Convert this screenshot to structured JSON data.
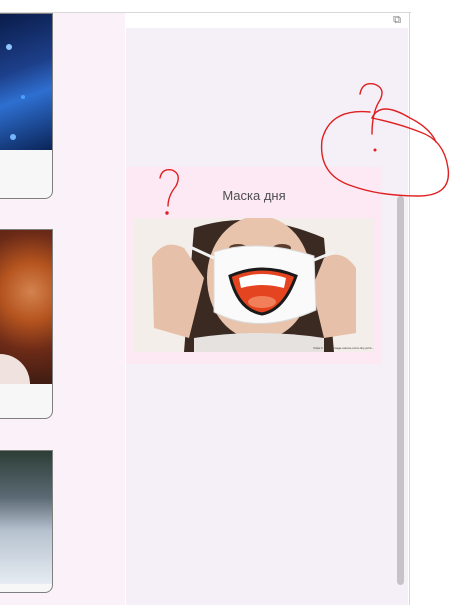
{
  "widget": {
    "title": "Маска дня",
    "image_caption": "https://...mask-image-source-url-in-tiny-print..."
  },
  "icons": {
    "corner": "window-restore-icon"
  },
  "annotations": {
    "marks": [
      "?",
      "?"
    ]
  },
  "colors": {
    "left_column_bg": "#fbf2f9",
    "right_panel_bg": "#f5eff7",
    "widget_bg": "#fce9f3",
    "annotation_red": "#e02020",
    "scrollbar": "#c5c3c6"
  }
}
